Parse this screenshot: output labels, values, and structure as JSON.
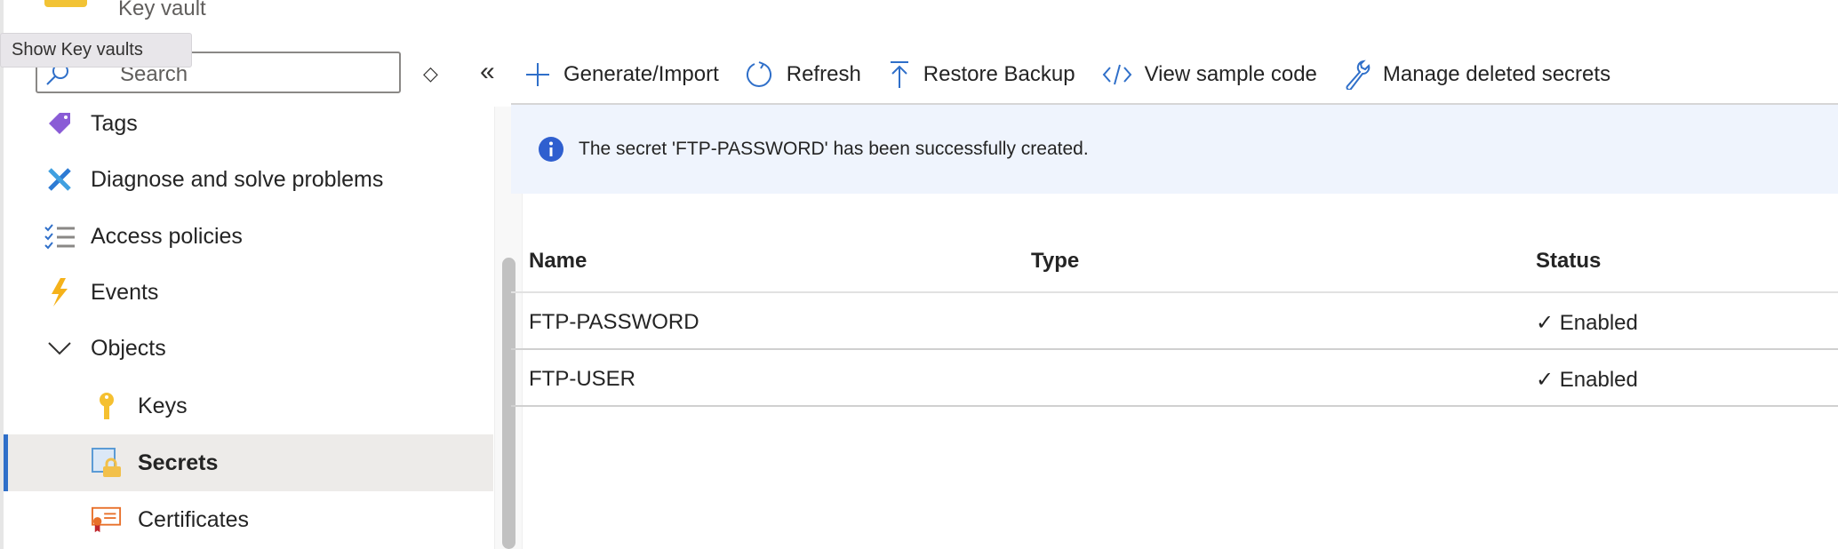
{
  "app": {
    "subtitle": "Key vault",
    "tooltip": "Show Key vaults"
  },
  "sidebar": {
    "search_placeholder": "Search",
    "items": [
      {
        "label": "Tags",
        "icon": "tag-icon"
      },
      {
        "label": "Diagnose and solve problems",
        "icon": "wrench-screwdriver-icon"
      },
      {
        "label": "Access policies",
        "icon": "checklist-icon"
      },
      {
        "label": "Events",
        "icon": "lightning-icon"
      },
      {
        "label": "Objects",
        "icon": "chevron-down-icon",
        "expanded": true
      },
      {
        "label": "Keys",
        "icon": "key-icon"
      },
      {
        "label": "Secrets",
        "icon": "secret-lock-icon",
        "selected": true
      },
      {
        "label": "Certificates",
        "icon": "certificate-icon"
      }
    ]
  },
  "toolbar": {
    "generate": "Generate/Import",
    "refresh": "Refresh",
    "restore": "Restore Backup",
    "sample": "View sample code",
    "manage": "Manage deleted secrets"
  },
  "banner": {
    "message": "The secret 'FTP-PASSWORD' has been successfully created."
  },
  "table": {
    "headers": [
      "Name",
      "Type",
      "Status"
    ],
    "rows": [
      {
        "name": "FTP-PASSWORD",
        "type": "",
        "status": "Enabled"
      },
      {
        "name": "FTP-USER",
        "type": "",
        "status": "Enabled"
      }
    ]
  },
  "colors": {
    "accent": "#2f6fc9",
    "banner_bg": "#eff4fd",
    "selected_bg": "#edebe9"
  }
}
